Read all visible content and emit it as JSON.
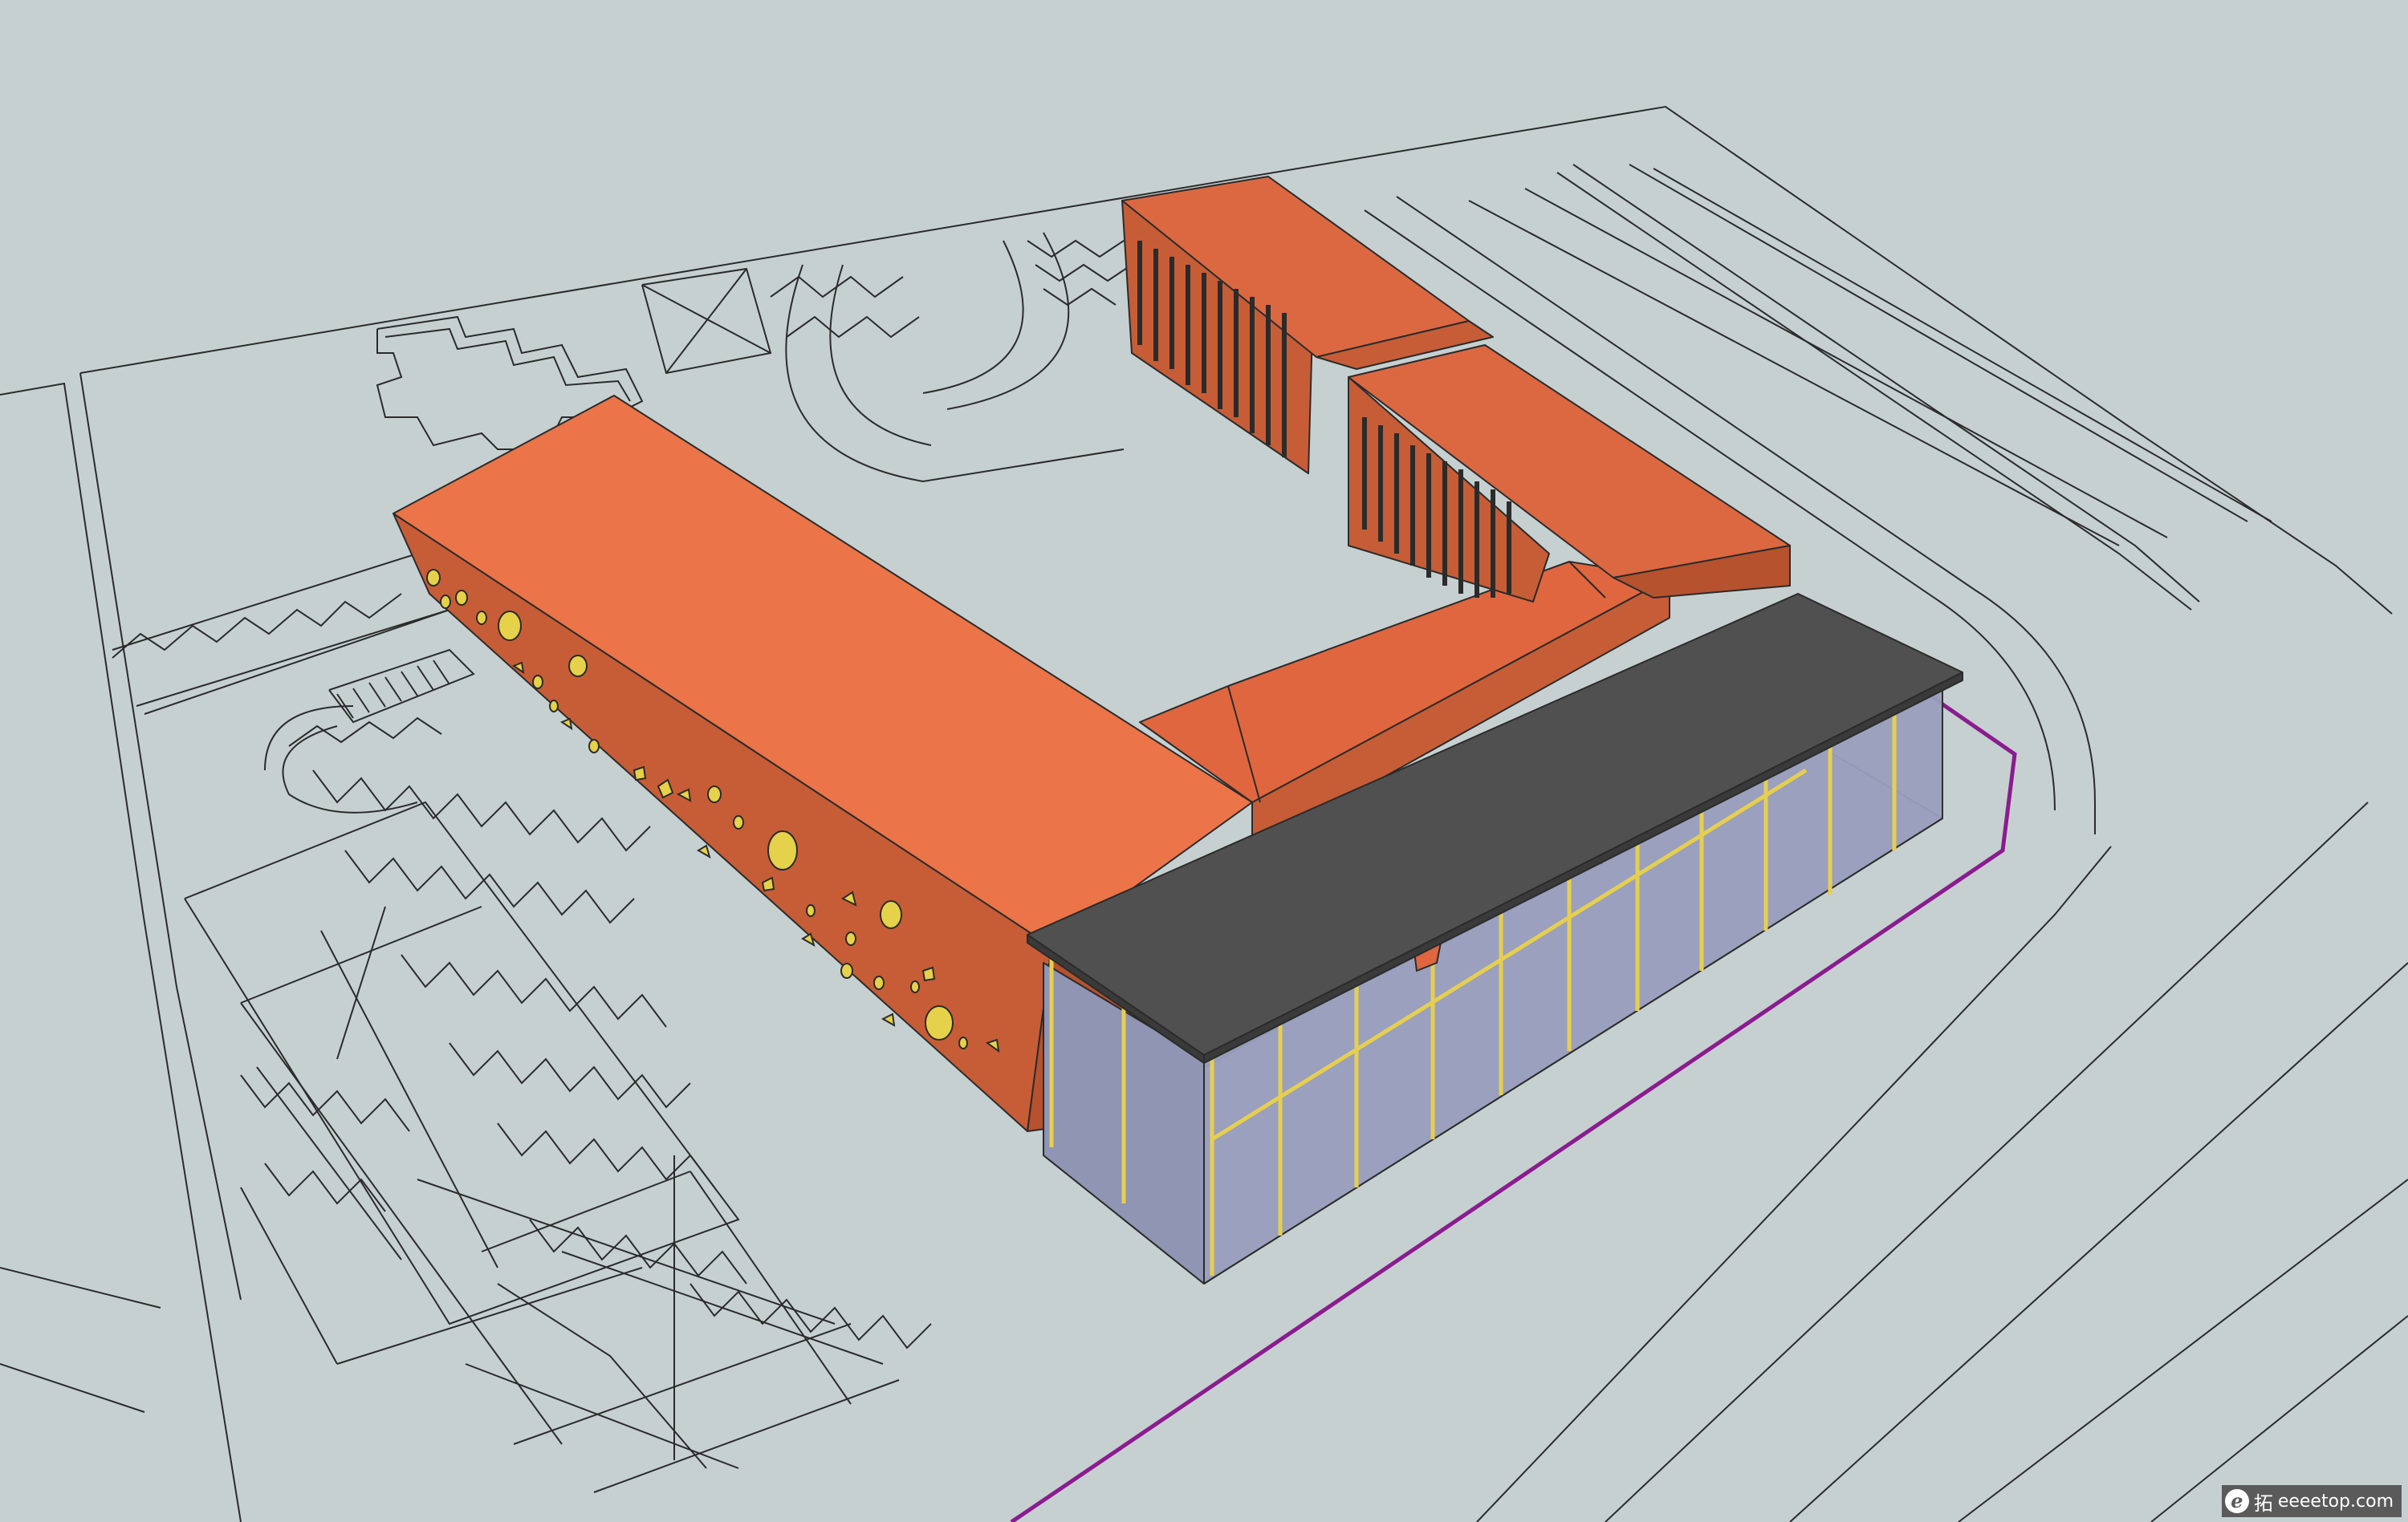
{
  "scene": {
    "type": "3d-architectural-model",
    "colors": {
      "ground": "#c6d0d0",
      "line": "#2b2b2b",
      "orange_top": "#ec7449",
      "orange_side": "#c65d37",
      "orange_dark": "#a84d2d",
      "roof_canopy": "#505050",
      "glass": "#9aa0bd",
      "mullion": "#e6cf4e",
      "boundary": "#8b1c90"
    }
  },
  "watermark": {
    "logo_letter": "e",
    "han": "拓",
    "site": "eeeetop.com"
  }
}
